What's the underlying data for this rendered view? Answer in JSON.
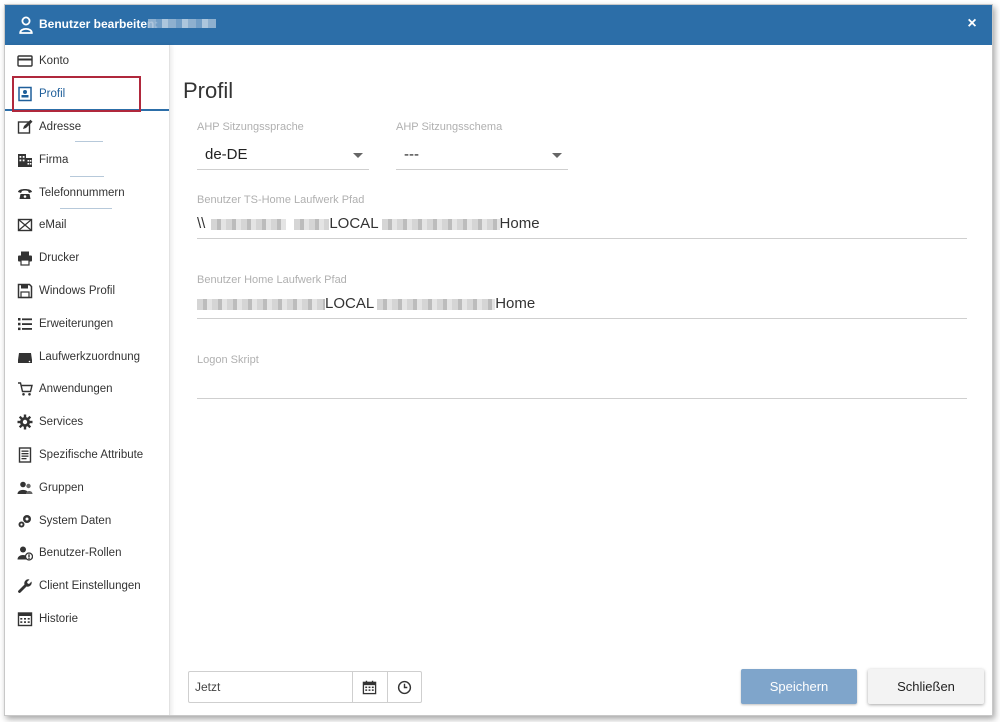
{
  "window": {
    "title": "Benutzer bearbeiten:",
    "close_symbol": "×",
    "accent_color": "#2c6ea8"
  },
  "sidebar": {
    "active": "Profil",
    "items": [
      {
        "label": "Konto",
        "icon": "credit-card-icon"
      },
      {
        "label": "Profil",
        "icon": "profile-card-icon"
      },
      {
        "label": "Adresse",
        "icon": "edit-icon"
      },
      {
        "label": "Firma",
        "icon": "building-icon"
      },
      {
        "label": "Telefonnummern",
        "icon": "phone-icon"
      },
      {
        "label": "eMail",
        "icon": "mail-icon"
      },
      {
        "label": "Drucker",
        "icon": "printer-icon"
      },
      {
        "label": "Windows Profil",
        "icon": "floppy-disk-icon"
      },
      {
        "label": "Erweiterungen",
        "icon": "list-icon"
      },
      {
        "label": "Laufwerkzuordnung",
        "icon": "drive-icon"
      },
      {
        "label": "Anwendungen",
        "icon": "cart-icon"
      },
      {
        "label": "Services",
        "icon": "gear-icon"
      },
      {
        "label": "Spezifische Attribute",
        "icon": "document-icon"
      },
      {
        "label": "Gruppen",
        "icon": "users-icon"
      },
      {
        "label": "System Daten",
        "icon": "gears-icon"
      },
      {
        "label": "Benutzer-Rollen",
        "icon": "user-role-icon"
      },
      {
        "label": "Client Einstellungen",
        "icon": "wrench-icon"
      },
      {
        "label": "Historie",
        "icon": "calendar-grid-icon"
      }
    ]
  },
  "main": {
    "title": "Profil",
    "language": {
      "label": "AHP Sitzungssprache",
      "value": "de-DE"
    },
    "schema": {
      "label": "AHP Sitzungsschema",
      "value": "---"
    },
    "ts_home": {
      "label": "Benutzer TS-Home Laufwerk Pfad",
      "prefix": "\\\\",
      "middle": "LOCAL",
      "suffix": "Home"
    },
    "home": {
      "label": "Benutzer Home Laufwerk Pfad",
      "middle": "LOCAL",
      "suffix": "Home"
    },
    "logon": {
      "label": "Logon Skript",
      "value": ""
    }
  },
  "footer": {
    "date_value": "Jetzt",
    "save_label": "Speichern",
    "close_label": "Schließen"
  }
}
